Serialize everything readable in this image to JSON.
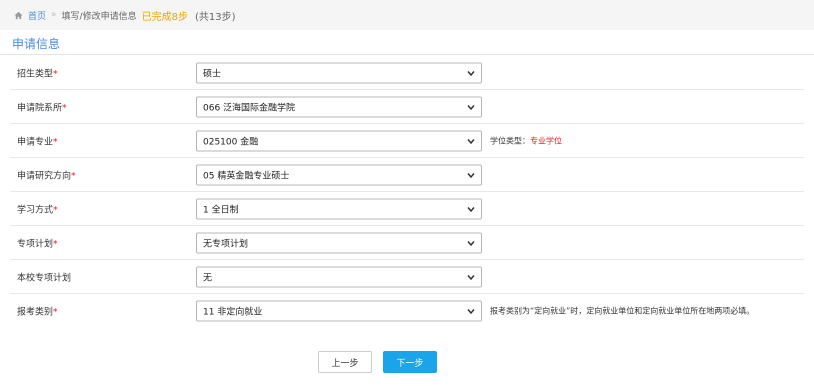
{
  "breadcrumb": {
    "home": "首页",
    "separator": "»",
    "current": "填写/修改申请信息",
    "done_text": "已完成8步",
    "total_text": "(共13步)"
  },
  "section": {
    "title": "申请信息"
  },
  "fields": [
    {
      "label": "招生类型",
      "required": "*",
      "value": "硕士"
    },
    {
      "label": "申请院系所",
      "required": "*",
      "value": "066 泛海国际金融学院"
    },
    {
      "label": "申请专业",
      "required": "*",
      "value": "025100 金融",
      "aside_label": "学位类型：",
      "aside_value": "专业学位"
    },
    {
      "label": "申请研究方向",
      "required": "*",
      "value": "05 精英金融专业硕士"
    },
    {
      "label": "学习方式",
      "required": "*",
      "value": "1 全日制"
    },
    {
      "label": "专项计划",
      "required": "*",
      "value": "无专项计划"
    },
    {
      "label": "本校专项计划",
      "required": "",
      "value": "无"
    },
    {
      "label": "报考类别",
      "required": "*",
      "value": "11 非定向就业",
      "aside_label": "报考类别为“定向就业”时，定向就业单位和定向就业单位所在地两项必填。"
    }
  ],
  "buttons": {
    "prev": "上一步",
    "next": "下一步"
  },
  "colors": {
    "accent": "#4a8ed6",
    "required": "#e02020",
    "progress": "#f0a00c",
    "primary_button": "#1aa5ea"
  }
}
